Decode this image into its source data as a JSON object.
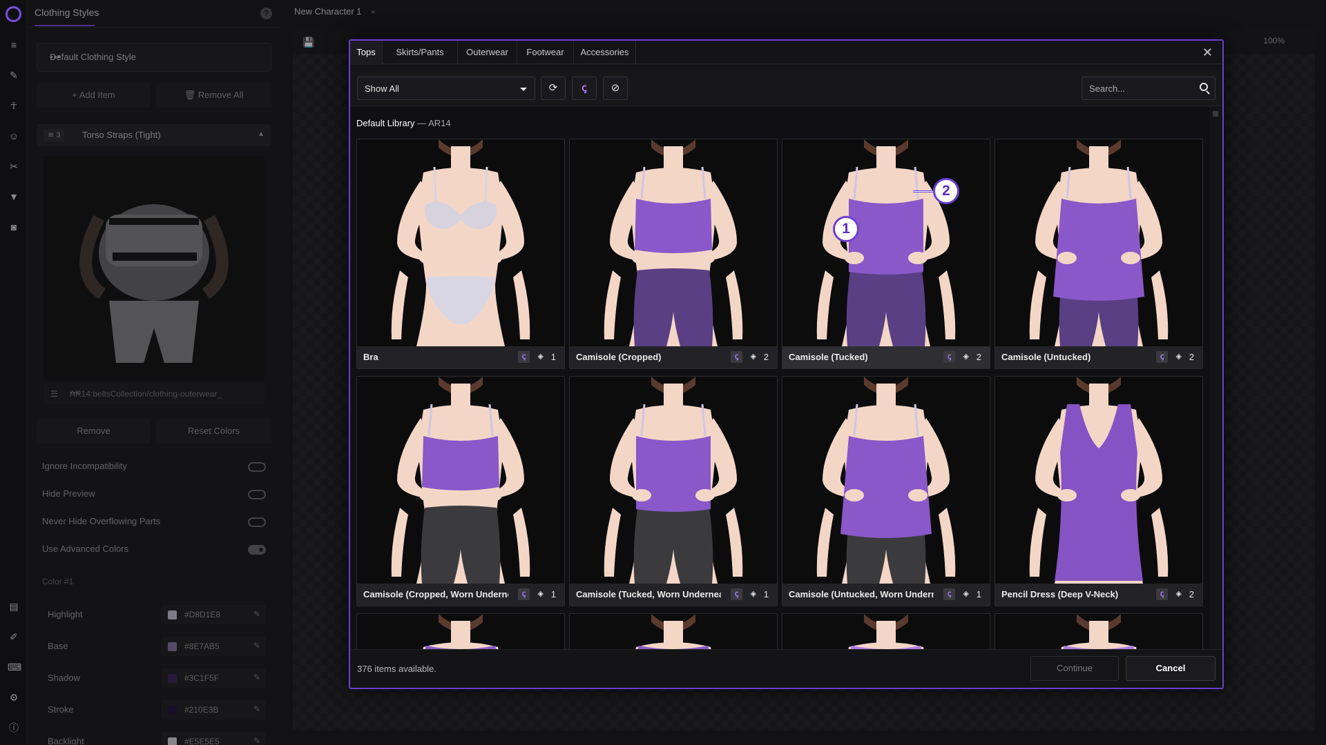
{
  "left_panel": {
    "title": "Clothing Styles",
    "help_icon": "question-circle-icon",
    "style_name": "Default Clothing Style",
    "add_item": "Add Item",
    "remove_all": "Remove All",
    "item_layer_count": "3",
    "item_name": "Torso Straps (Tight)",
    "item_path": "AR14:beltsCollection/clothing-outerwear_",
    "remove": "Remove",
    "reset_colors": "Reset Colors",
    "toggles": [
      {
        "label": "Ignore Incompatibility",
        "on": false
      },
      {
        "label": "Hide Preview",
        "on": false
      },
      {
        "label": "Never Hide Overflowing Parts",
        "on": false
      },
      {
        "label": "Use Advanced Colors",
        "on": true
      }
    ],
    "color_header": "Color #1",
    "colors": [
      {
        "name": "Highlight",
        "hex": "#D8D1E8"
      },
      {
        "name": "Base",
        "hex": "#8E7AB5"
      },
      {
        "name": "Shadow",
        "hex": "#3C1F5F"
      },
      {
        "name": "Stroke",
        "hex": "#210E3B"
      },
      {
        "name": "Backlight",
        "hex": "#E5E5E5"
      }
    ]
  },
  "main": {
    "document_tab": "New Character 1",
    "zoom": "100%"
  },
  "modal": {
    "tabs": [
      "Tops",
      "Skirts/Pants",
      "Outerwear",
      "Footwear",
      "Accessories"
    ],
    "active_tab": "Tops",
    "filter_value": "Show All",
    "search_placeholder": "Search...",
    "library_name": "Default Library",
    "library_sep": " — ",
    "library_code": "AR14",
    "items": [
      {
        "name": "Bra",
        "layers": "1",
        "top": "bra",
        "top_color": "#d6d3df",
        "bottom": "panty",
        "bottom_color": "#d9d6e4"
      },
      {
        "name": "Camisole (Cropped)",
        "layers": "2",
        "top": "crop",
        "top_color": "#8a58c9",
        "bottom": "pants",
        "bottom_color": "#5a3f84"
      },
      {
        "name": "Camisole (Tucked)",
        "layers": "2",
        "top": "tucked",
        "top_color": "#8a58c9",
        "bottom": "pants",
        "bottom_color": "#5a3f84"
      },
      {
        "name": "Camisole (Untucked)",
        "layers": "2",
        "top": "untucked",
        "top_color": "#8a58c9",
        "bottom": "pants",
        "bottom_color": "#5a3f84"
      },
      {
        "name": "Camisole (Cropped, Worn Underneath)",
        "layers": "1",
        "top": "crop",
        "top_color": "#8a58c9",
        "bottom": "pants",
        "bottom_color": "#3b3b3e"
      },
      {
        "name": "Camisole (Tucked, Worn Underneath)",
        "layers": "1",
        "top": "tucked",
        "top_color": "#8a58c9",
        "bottom": "pants",
        "bottom_color": "#3b3b3e"
      },
      {
        "name": "Camisole (Untucked, Worn Underneath)",
        "layers": "1",
        "top": "untucked",
        "top_color": "#8a58c9",
        "bottom": "pants",
        "bottom_color": "#3b3b3e"
      },
      {
        "name": "Pencil Dress (Deep V-Neck)",
        "layers": "2",
        "top": "dress",
        "top_color": "#8653c4",
        "bottom": "none",
        "bottom_color": "#8653c4"
      }
    ],
    "partial_row_colors": [
      "#8a58c9",
      "#8a58c9",
      "#b07be8",
      "#b07be8"
    ],
    "callouts": [
      "1",
      "2"
    ],
    "items_available": "376 items available.",
    "continue": "Continue",
    "cancel": "Cancel"
  }
}
